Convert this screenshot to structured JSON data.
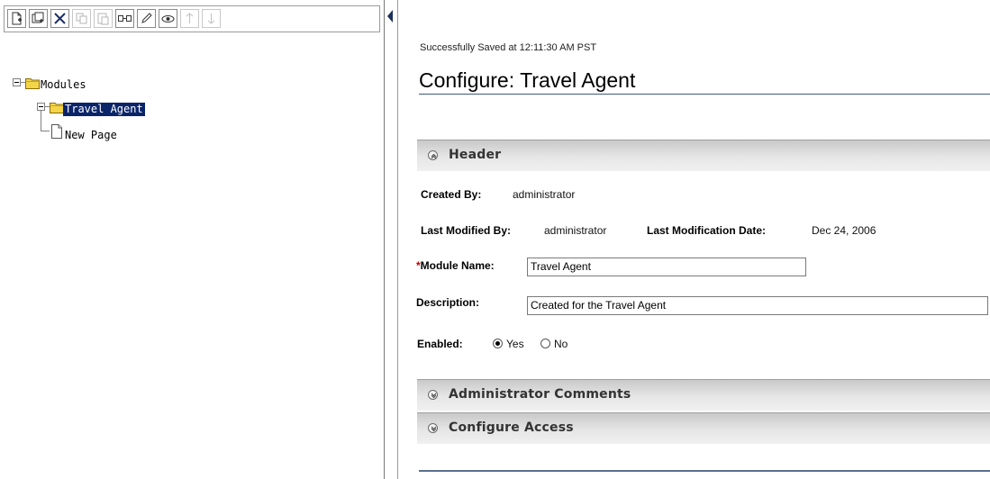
{
  "toolbar": {
    "buttons": [
      {
        "name": "new-page-icon",
        "enabled": true
      },
      {
        "name": "new-module-icon",
        "enabled": true
      },
      {
        "name": "delete-icon",
        "enabled": true
      },
      {
        "name": "copy-icon",
        "enabled": false
      },
      {
        "name": "paste-icon",
        "enabled": false
      },
      {
        "name": "link-icon",
        "enabled": true
      },
      {
        "name": "edit-icon",
        "enabled": true
      },
      {
        "name": "preview-icon",
        "enabled": true
      },
      {
        "name": "move-up-icon",
        "enabled": false
      },
      {
        "name": "move-down-icon",
        "enabled": false
      }
    ]
  },
  "tree": {
    "root": {
      "label": "Modules",
      "expanded": true
    },
    "module": {
      "label": "Travel Agent",
      "expanded": true,
      "selected": true
    },
    "page": {
      "label": "New Page"
    }
  },
  "main": {
    "status": "Successfully Saved at 12:11:30 AM PST",
    "title": "Configure: Travel Agent",
    "sections": {
      "header": "Header",
      "admin_comments": "Administrator Comments",
      "configure_access": "Configure Access"
    },
    "fields": {
      "created_by_label": "Created By:",
      "created_by_value": "administrator",
      "last_modified_by_label": "Last Modified By:",
      "last_modified_by_value": "administrator",
      "last_mod_date_label": "Last Modification Date:",
      "last_mod_date_value": "Dec 24, 2006",
      "required_mark": "*",
      "module_name_label": "Module Name:",
      "module_name_value": "Travel Agent",
      "description_label": "Description:",
      "description_value": "Created for the Travel Agent",
      "enabled_label": "Enabled:",
      "enabled_yes": "Yes",
      "enabled_no": "No",
      "enabled_selected": "Yes"
    }
  },
  "colors": {
    "selection": "#0a246a",
    "title_rule": "#3d5a86",
    "section_bar": "#d8d8d8",
    "required": "#c00000"
  }
}
